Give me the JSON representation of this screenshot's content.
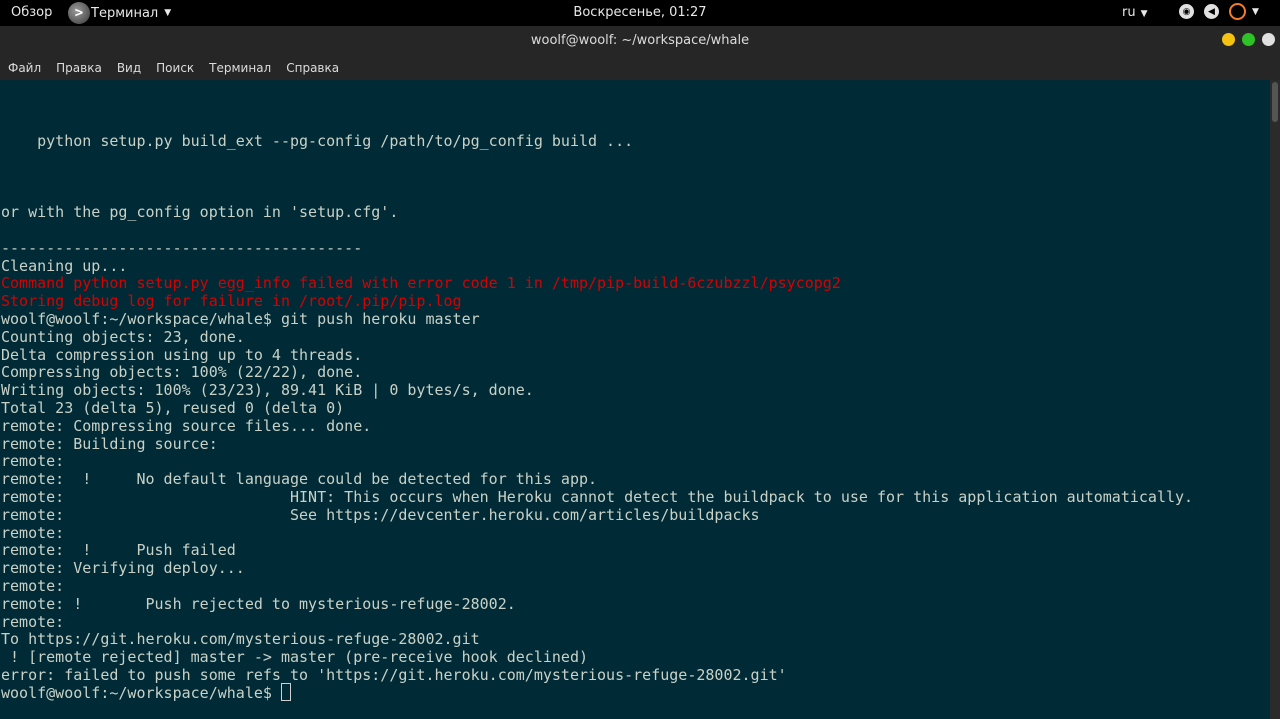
{
  "topbar": {
    "activities": "Обзор",
    "app_icon": ">",
    "app_name": "Терминал",
    "clock": "Воскресенье, 01:27",
    "lang": "ru",
    "icons": [
      "network-icon",
      "volume-icon",
      "power-icon"
    ]
  },
  "window": {
    "title": "woolf@woolf: ~/workspace/whale"
  },
  "menubar": {
    "items": [
      "Файл",
      "Правка",
      "Вид",
      "Поиск",
      "Терминал",
      "Справка"
    ]
  },
  "terminal": {
    "lines": [
      {
        "text": "    python setup.py build_ext --pg-config /path/to/pg_config build ...",
        "style": "normal"
      },
      {
        "text": "",
        "style": "normal"
      },
      {
        "text": "",
        "style": "normal"
      },
      {
        "text": "",
        "style": "normal"
      },
      {
        "text": "or with the pg_config option in 'setup.cfg'.",
        "style": "normal"
      },
      {
        "text": "",
        "style": "normal"
      },
      {
        "text": "----------------------------------------",
        "style": "normal"
      },
      {
        "text": "Cleaning up...",
        "style": "normal"
      },
      {
        "text": "Command python setup.py egg_info failed with error code 1 in /tmp/pip-build-6czubzzl/psycopg2",
        "style": "red"
      },
      {
        "text": "Storing debug log for failure in /root/.pip/pip.log",
        "style": "red"
      },
      {
        "text": "woolf@woolf:~/workspace/whale$ git push heroku master",
        "style": "normal"
      },
      {
        "text": "Counting objects: 23, done.",
        "style": "normal"
      },
      {
        "text": "Delta compression using up to 4 threads.",
        "style": "normal"
      },
      {
        "text": "Compressing objects: 100% (22/22), done.",
        "style": "normal"
      },
      {
        "text": "Writing objects: 100% (23/23), 89.41 KiB | 0 bytes/s, done.",
        "style": "normal"
      },
      {
        "text": "Total 23 (delta 5), reused 0 (delta 0)",
        "style": "normal"
      },
      {
        "text": "remote: Compressing source files... done.",
        "style": "normal"
      },
      {
        "text": "remote: Building source:",
        "style": "normal"
      },
      {
        "text": "remote:",
        "style": "normal"
      },
      {
        "text": "remote:  !     No default language could be detected for this app.",
        "style": "normal"
      },
      {
        "text": "remote:                         HINT: This occurs when Heroku cannot detect the buildpack to use for this application automatically.",
        "style": "normal"
      },
      {
        "text": "remote:                         See https://devcenter.heroku.com/articles/buildpacks",
        "style": "normal"
      },
      {
        "text": "remote:",
        "style": "normal"
      },
      {
        "text": "remote:  !     Push failed",
        "style": "normal"
      },
      {
        "text": "remote: Verifying deploy...",
        "style": "normal"
      },
      {
        "text": "remote:",
        "style": "normal"
      },
      {
        "text": "remote: !       Push rejected to mysterious-refuge-28002.",
        "style": "normal"
      },
      {
        "text": "remote:",
        "style": "normal"
      },
      {
        "text": "To https://git.heroku.com/mysterious-refuge-28002.git",
        "style": "normal"
      },
      {
        "text": " ! [remote rejected] master -> master (pre-receive hook declined)",
        "style": "normal"
      },
      {
        "text": "error: failed to push some refs to 'https://git.heroku.com/mysterious-refuge-28002.git'",
        "style": "normal"
      }
    ],
    "prompt": "woolf@woolf:~/workspace/whale$"
  }
}
